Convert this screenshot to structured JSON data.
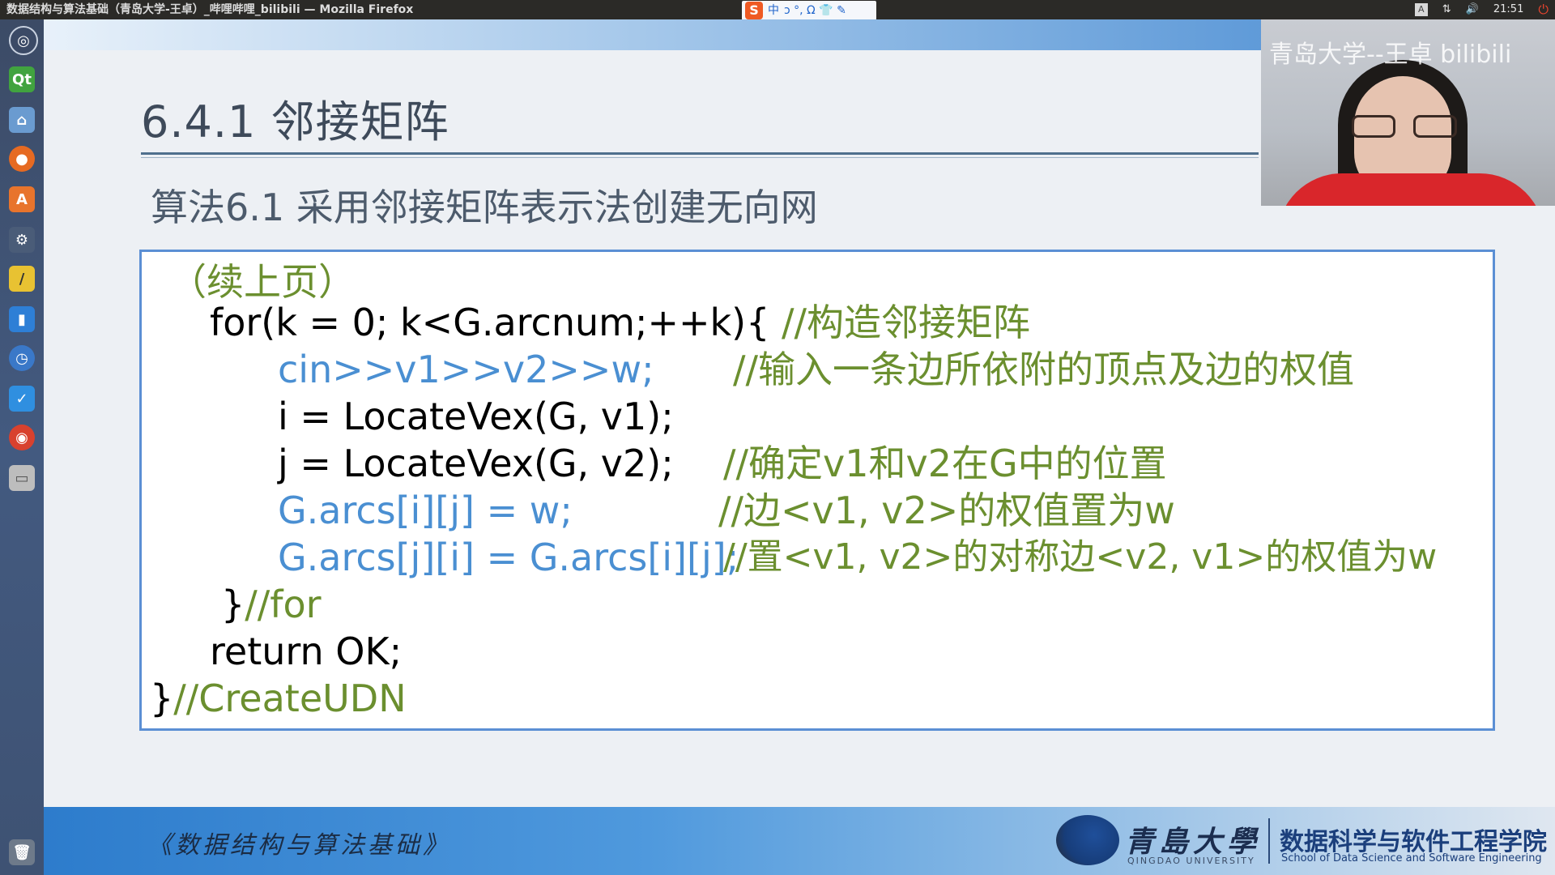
{
  "window": {
    "title": "数据结构与算法基础（青岛大学-王卓）_哔哩哔哩_bilibili — Mozilla Firefox"
  },
  "ime": {
    "logo": "S",
    "mode": "中",
    "glyphs": "ↄ °, Ω 👕 ✎"
  },
  "tray": {
    "keyboard": "A",
    "network": "⇅",
    "volume": "🔊",
    "time": "21:51",
    "power": "⏻"
  },
  "launcher": {
    "items": [
      {
        "name": "ubuntu-dash-icon",
        "glyph": "◎",
        "color": "#3b4a66"
      },
      {
        "name": "qt-creator-icon",
        "glyph": "Qt",
        "color": "#41a33f"
      },
      {
        "name": "files-icon",
        "glyph": "⌂",
        "color": "#6a9bd0"
      },
      {
        "name": "firefox-icon",
        "glyph": "●",
        "color": "#e66a22"
      },
      {
        "name": "software-center-icon",
        "glyph": "A",
        "color": "#e8742c"
      },
      {
        "name": "settings-icon",
        "glyph": "⚙",
        "color": "#4a5c78"
      },
      {
        "name": "text-editor-icon",
        "glyph": "/",
        "color": "#e8c232"
      },
      {
        "name": "monitor-icon",
        "glyph": "▮",
        "color": "#2e7fd6"
      },
      {
        "name": "clock-icon",
        "glyph": "◷",
        "color": "#3a78c8"
      },
      {
        "name": "notes-icon",
        "glyph": "✓",
        "color": "#2f8fe0"
      },
      {
        "name": "chrome-icon",
        "glyph": "◉",
        "color": "#d8412e"
      },
      {
        "name": "disk-icon",
        "glyph": "▭",
        "color": "#bdbdbd"
      },
      {
        "name": "trash-icon",
        "glyph": "🗑",
        "color": "#6e7a8a"
      }
    ]
  },
  "slide": {
    "title": "6.4.1 邻接矩阵",
    "subtitle": "算法6.1 采用邻接矩阵表示法创建无向网",
    "code": {
      "line1": "（续上页）",
      "line2_code": "for(k = 0; k<G.arcnum;++k){",
      "line2_comment": "//构造邻接矩阵",
      "line3_code": "cin>>v1>>v2>>w;",
      "line3_comment": "//输入一条边所依附的顶点及边的权值",
      "line4_code": "i = LocateVex(G, v1);",
      "line5_code": "j = LocateVex(G, v2);",
      "line5_comment": "//确定v1和v2在G中的位置",
      "line6_code": "G.arcs[i][j] = w;",
      "line6_comment": "//边<v1, v2>的权值置为w",
      "line7_code": "G.arcs[j][i] = G.arcs[i][j];",
      "line7_comment": "//置<v1, v2>的对称边<v2, v1>的权值为w",
      "line8_brace": "}",
      "line8_comment": "//for",
      "line9_code": "return OK;",
      "line10_brace": "}",
      "line10_comment": "//CreateUDN"
    },
    "footer": {
      "book": "《数据结构与算法基础》",
      "university_cn": "青島大學",
      "university_en": "QINGDAO UNIVERSITY",
      "school_cn": "数据科学与软件工程学院",
      "school_en": "School of Data Science and Software Engineering"
    }
  },
  "webcam": {
    "watermark": "青岛大学--王卓 bilibili"
  },
  "colors": {
    "code_black": "#000000",
    "code_blue": "#4a8fd2",
    "comment_green": "#6b8f2f",
    "box_border": "#5b8fd4"
  }
}
